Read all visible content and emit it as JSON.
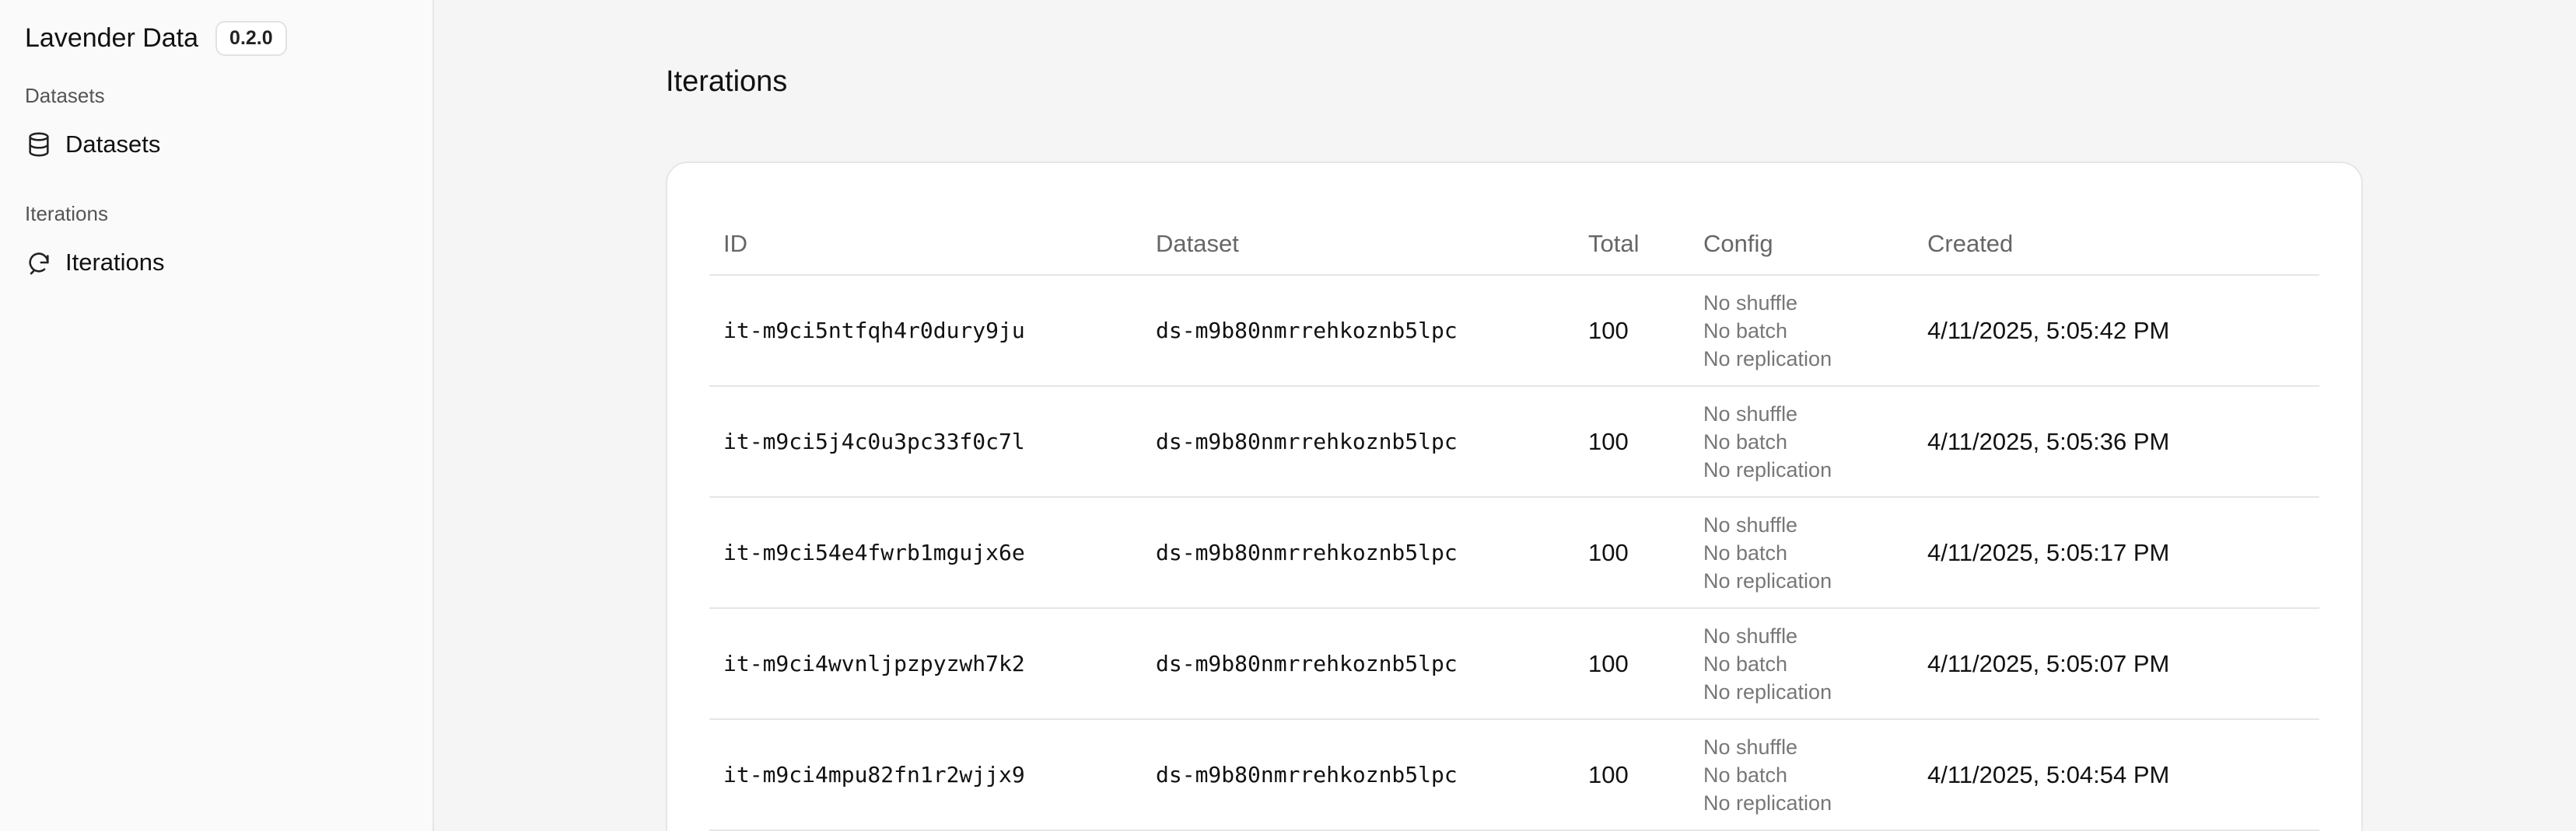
{
  "sidebar": {
    "brand": "Lavender Data",
    "version": "0.2.0",
    "groups": [
      {
        "label": "Datasets",
        "item": {
          "label": "Datasets",
          "icon": "database-icon"
        }
      },
      {
        "label": "Iterations",
        "item": {
          "label": "Iterations",
          "icon": "refresh-icon"
        }
      }
    ]
  },
  "main": {
    "title": "Iterations",
    "table": {
      "headers": [
        "ID",
        "Dataset",
        "Total",
        "Config",
        "Created"
      ],
      "rows": [
        {
          "id": "it-m9ci5ntfqh4r0dury9ju",
          "dataset": "ds-m9b80nmrrehkoznb5lpc",
          "total": "100",
          "config": [
            "No shuffle",
            "No batch",
            "No replication"
          ],
          "created": "4/11/2025, 5:05:42 PM"
        },
        {
          "id": "it-m9ci5j4c0u3pc33f0c7l",
          "dataset": "ds-m9b80nmrrehkoznb5lpc",
          "total": "100",
          "config": [
            "No shuffle",
            "No batch",
            "No replication"
          ],
          "created": "4/11/2025, 5:05:36 PM"
        },
        {
          "id": "it-m9ci54e4fwrb1mgujx6e",
          "dataset": "ds-m9b80nmrrehkoznb5lpc",
          "total": "100",
          "config": [
            "No shuffle",
            "No batch",
            "No replication"
          ],
          "created": "4/11/2025, 5:05:17 PM"
        },
        {
          "id": "it-m9ci4wvnljpzpyzwh7k2",
          "dataset": "ds-m9b80nmrrehkoznb5lpc",
          "total": "100",
          "config": [
            "No shuffle",
            "No batch",
            "No replication"
          ],
          "created": "4/11/2025, 5:05:07 PM"
        },
        {
          "id": "it-m9ci4mpu82fn1r2wjjx9",
          "dataset": "ds-m9b80nmrrehkoznb5lpc",
          "total": "100",
          "config": [
            "No shuffle",
            "No batch",
            "No replication"
          ],
          "created": "4/11/2025, 5:04:54 PM"
        }
      ]
    }
  }
}
